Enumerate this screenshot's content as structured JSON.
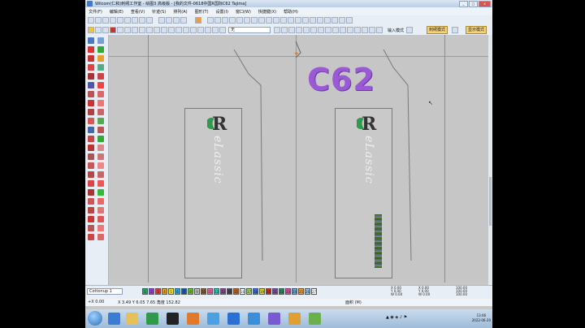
{
  "window": {
    "title": "Wilcom(仁和)刺绣工作室 - 绘图3 高级版 - [我的文件-0618中国R国际C62     Tajima]",
    "controls": [
      "_",
      "□",
      "x"
    ]
  },
  "menu": [
    "文件(F)",
    "编辑(E)",
    "查看(V)",
    "针迹(S)",
    "排列(A)",
    "图形(T)",
    "设置(I)",
    "窗口(W)",
    "快捷键(X)",
    "帮助(H)"
  ],
  "toolbar2": {
    "style_select": "无",
    "input_label": "输入模式",
    "input_button": "刺绣模式",
    "show_button": "显示模式"
  },
  "design": {
    "big_text": "C62",
    "logo_letter": "R",
    "vertical_text": "eLassic"
  },
  "statusbar": {
    "color_select": "Cottonup 1",
    "palette_numbers": [
      "1",
      "2",
      "3",
      "4",
      "5",
      "6",
      "7",
      "8",
      "9",
      "10",
      "11",
      "12",
      "13",
      "14",
      "15",
      "16",
      "17",
      "18",
      "19",
      "20",
      "21",
      "22",
      "23",
      "24",
      "25",
      "26",
      "27"
    ],
    "palette_colors": [
      "#26a269",
      "#8f3fd1",
      "#d53a3a",
      "#e0a21b",
      "#f2e21c",
      "#2aa7d8",
      "#1a52a6",
      "#6bbf3b",
      "#c0c0c0",
      "#8a5a2b",
      "#e26aa1",
      "#36c7b4",
      "#884488",
      "#444444",
      "#c45f1a",
      "#ffffff",
      "#a0d06b",
      "#3b6dd8",
      "#d8d83b",
      "#c4311e",
      "#7a4b9a",
      "#2e8b57",
      "#d94fa2",
      "#6fa0d6",
      "#f0a030",
      "#9cc3e0",
      "#ffffff"
    ],
    "fields_a": [
      "X 0.00",
      "Y 0.00",
      "W 0.00",
      "H 0.00"
    ],
    "fields_b": [
      "X 0.00",
      "Y 0.00",
      "W 0.00"
    ],
    "fields_c": [
      "100.00",
      "100.00",
      "100.00",
      "100.00"
    ]
  },
  "infobar": {
    "left": "+X 0.00",
    "coords": "X 3.49  Y 6.05     7.65 角度 152.82",
    "right": "面积 (M)"
  },
  "taskbar": {
    "clock_time": "13:46",
    "clock_date": "2022-06-20"
  }
}
